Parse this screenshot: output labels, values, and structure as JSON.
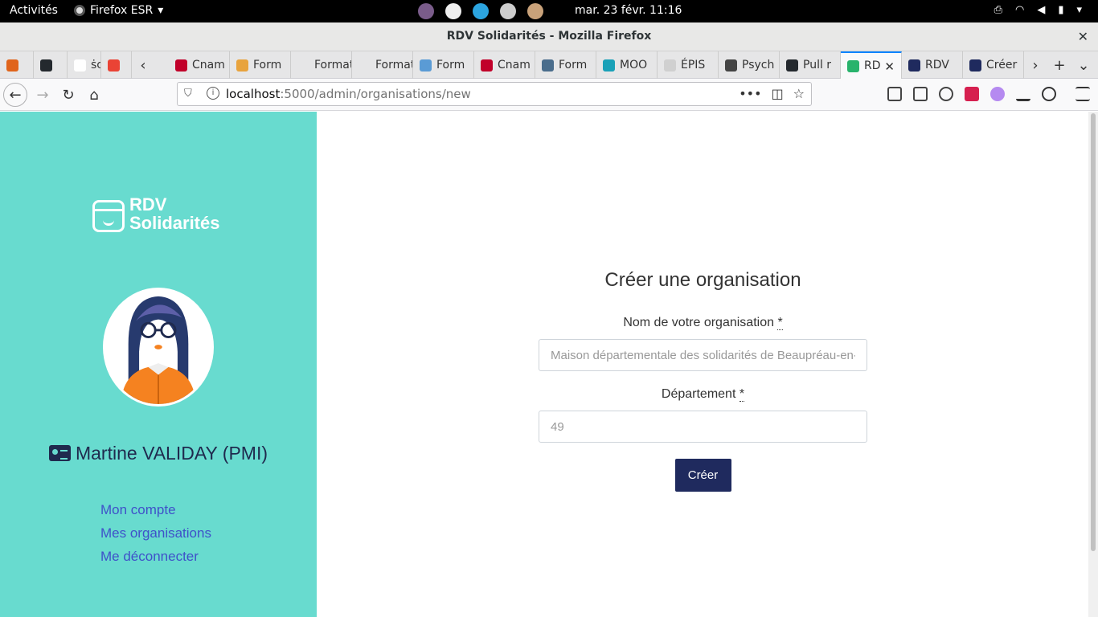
{
  "topbar": {
    "activities": "Activités",
    "app_menu": "Firefox ESR",
    "clock": "mar. 23 févr.  11:16"
  },
  "window": {
    "title": "RDV Solidarités - Mozilla Firefox",
    "close": "✕"
  },
  "tabs": [
    {
      "label": "",
      "favicon_color": "#e0641b"
    },
    {
      "label": "",
      "favicon_color": "#24292e"
    },
    {
      "label": "ṡc",
      "favicon_color": "#ffffff"
    },
    {
      "label": "",
      "favicon_color": "#ea4335"
    },
    {
      "label": "Cnam",
      "favicon_color": "#c1002a"
    },
    {
      "label": "Form",
      "favicon_color": "#e8a33d"
    },
    {
      "label": "Formatio",
      "favicon_color": "#e6e6e7"
    },
    {
      "label": "Formatio",
      "favicon_color": "#e6e6e7"
    },
    {
      "label": "Form",
      "favicon_color": "#5a9bd5"
    },
    {
      "label": "Cnam",
      "favicon_color": "#c1002a"
    },
    {
      "label": "Form",
      "favicon_color": "#4a6d8c"
    },
    {
      "label": "MOO",
      "favicon_color": "#1aa1b8"
    },
    {
      "label": "ÉPIS",
      "favicon_color": "#d0d0d0"
    },
    {
      "label": "Psych",
      "favicon_color": "#444444"
    },
    {
      "label": "Pull r",
      "favicon_color": "#24292e"
    },
    {
      "label": "RD",
      "favicon_color": "#29b36c"
    },
    {
      "label": "RDV",
      "favicon_color": "#1f2a5e"
    },
    {
      "label": "Créer",
      "favicon_color": "#1f2a5e"
    }
  ],
  "navbar": {
    "url_host": "localhost",
    "url_rest": ":5000/admin/organisations/new"
  },
  "sidebar": {
    "logo_line1": "RDV",
    "logo_line2": "Solidarités",
    "user_name": "Martine VALIDAY (PMI)",
    "links": [
      "Mon compte",
      "Mes organisations",
      "Me déconnecter"
    ]
  },
  "form": {
    "title": "Créer une organisation",
    "name_label": "Nom de votre organisation",
    "name_placeholder": "Maison départementale des solidarités de Beaupréau-en-Mauges",
    "dept_label": "Département",
    "dept_placeholder": "49",
    "required_mark": "*",
    "submit": "Créer"
  },
  "colors": {
    "sidebar_bg": "#68dbcf",
    "primary": "#1f2a5e",
    "link": "#3f51c9"
  }
}
